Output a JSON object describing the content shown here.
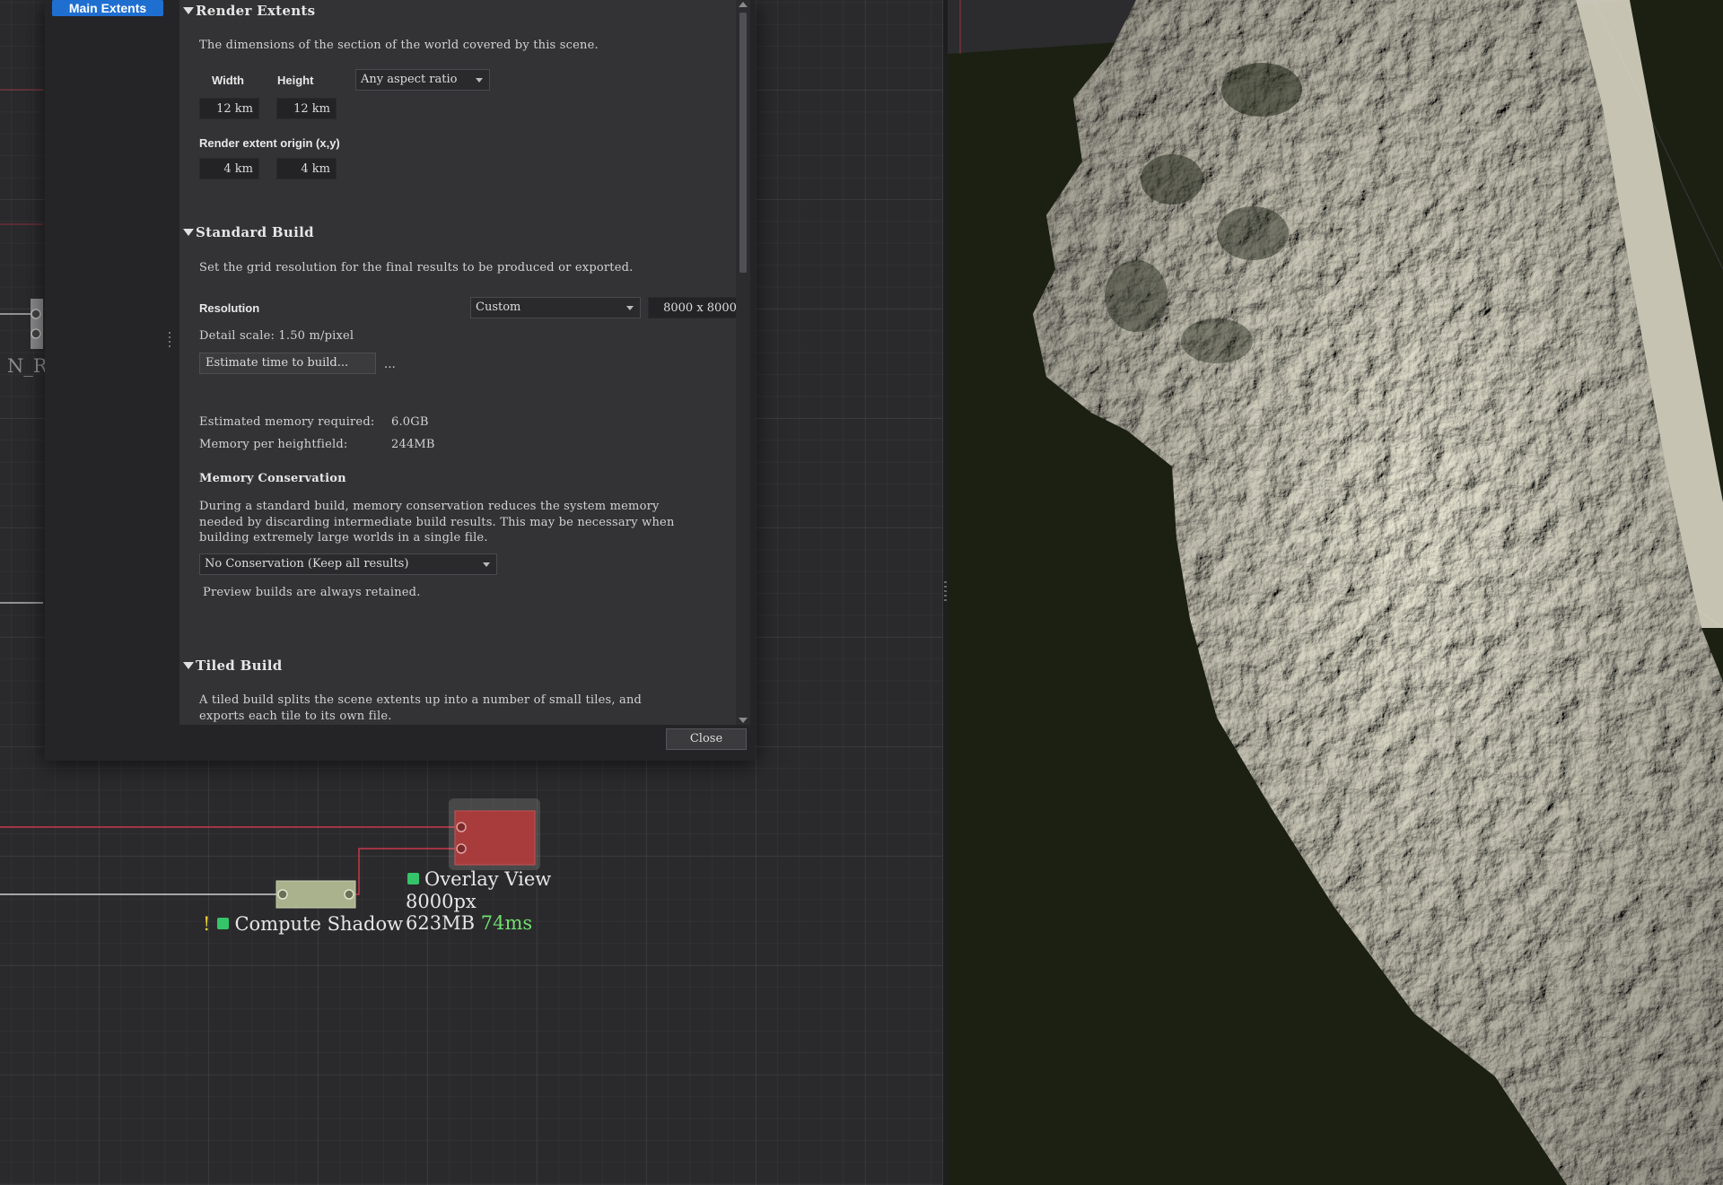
{
  "dialog": {
    "tab_label": "Main Extents",
    "close_label": "Close"
  },
  "render_extents": {
    "title": "Render Extents",
    "description": "The dimensions of the section of the world covered by this scene.",
    "width_label": "Width",
    "height_label": "Height",
    "aspect_option": "Any aspect ratio",
    "width_value": "12 km",
    "height_value": "12 km",
    "origin_label": "Render extent origin (x,y)",
    "origin_x": "4 km",
    "origin_y": "4 km"
  },
  "standard_build": {
    "title": "Standard Build",
    "description": "Set the grid resolution for the final results to be produced or exported.",
    "resolution_label": "Resolution",
    "resolution_option": "Custom",
    "resolution_value": "8000 x 8000",
    "detail_scale": "Detail scale: 1.50 m/pixel",
    "estimate_button": "Estimate time to build...",
    "estimate_result": "...",
    "memory_required_label": "Estimated memory required:",
    "memory_required_value": "6.0GB",
    "memory_per_hf_label": "Memory per heightfield:",
    "memory_per_hf_value": "244MB",
    "conservation_title": "Memory Conservation",
    "conservation_desc_1": "During a standard build, memory conservation reduces the system memory",
    "conservation_desc_2": "needed by discarding intermediate build results. This may be necessary when",
    "conservation_desc_3": "building extremely large worlds in a single file.",
    "conservation_option": "No Conservation (Keep all results)",
    "preview_note": "Preview builds are always retained."
  },
  "tiled_build": {
    "title": "Tiled Build",
    "desc_1": "A tiled build splits the scene extents up into a number of small tiles, and",
    "desc_2": "exports each tile to its own file."
  },
  "graph": {
    "partial_node_label": "N_R",
    "overlay_node": {
      "name": "Overlay View",
      "resolution": "8000px",
      "memory": "623MB",
      "time": "74ms"
    },
    "shadow_node": {
      "warning": "!",
      "name": "Compute Shadow"
    }
  },
  "colors": {
    "tab_accent": "#1f6fd1",
    "status_green": "#35c46a",
    "time_green": "#6fe06f",
    "overlay_node_fill": "#a83c3c",
    "shadow_node_fill": "#a9b28d",
    "wire_red": "#c8384a",
    "terrain_light": "#e9e6d4",
    "terrain_shadow": "#1b2013"
  }
}
